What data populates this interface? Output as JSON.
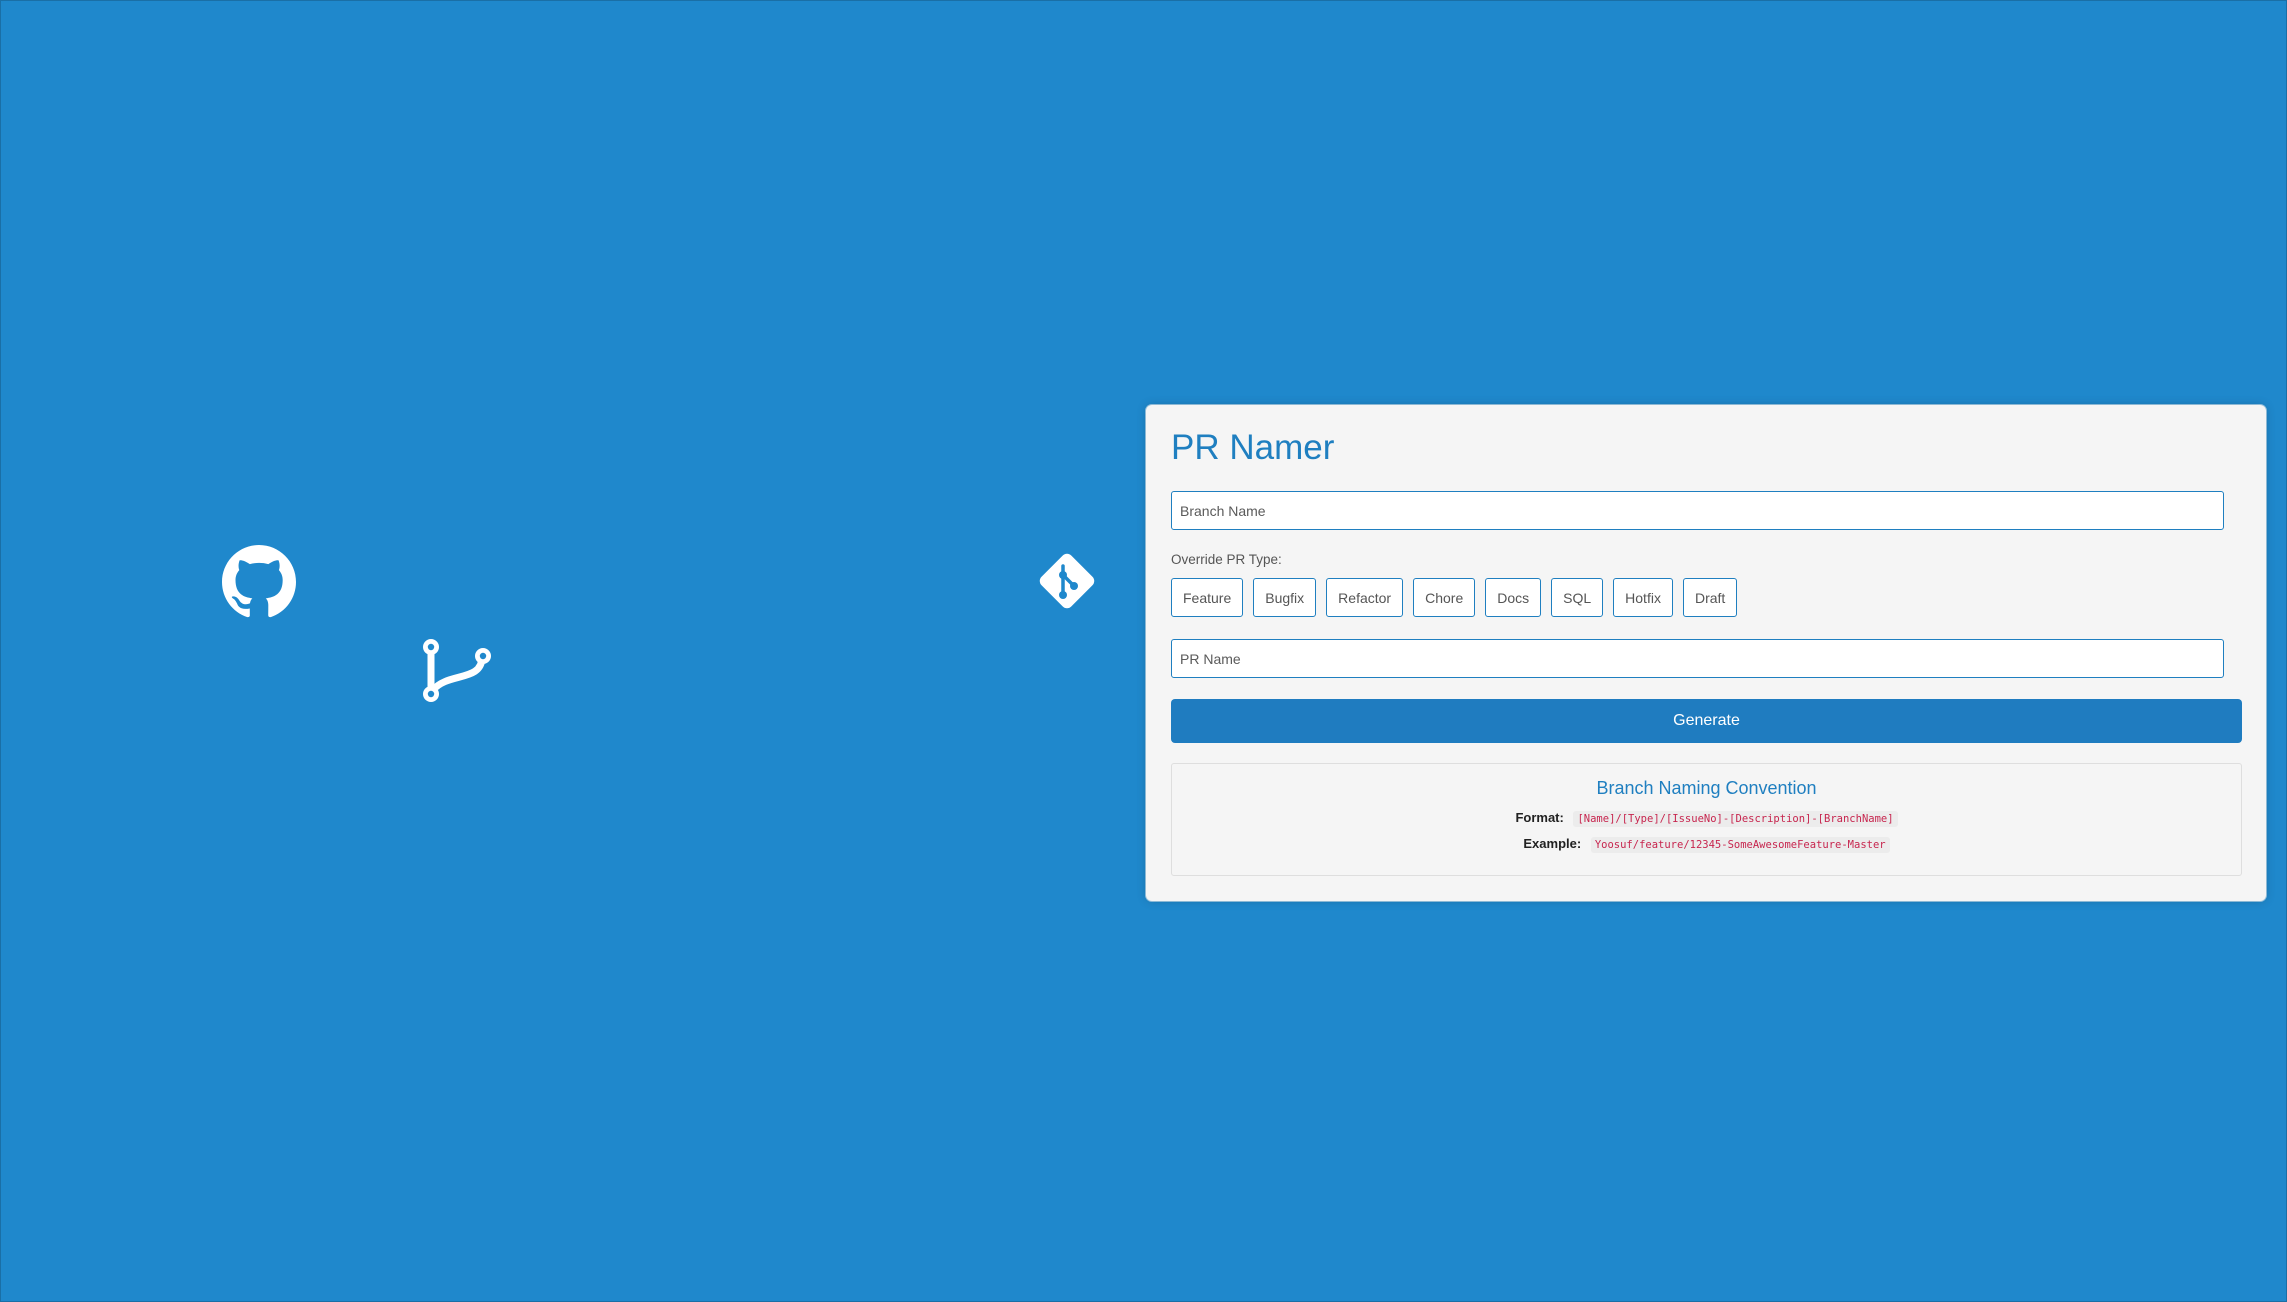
{
  "background_icons": {
    "github": "github-octocat-icon",
    "branch": "git-branch-icon",
    "git": "git-logo-icon"
  },
  "colors": {
    "background": "#1f88cc",
    "accent": "#1f7fc0",
    "card": "#f5f5f5",
    "code_text": "#c7254e"
  },
  "app": {
    "title": "PR Namer"
  },
  "branch_input": {
    "placeholder": "Branch Name",
    "value": ""
  },
  "override": {
    "label": "Override PR Type:",
    "types": [
      "Feature",
      "Bugfix",
      "Refactor",
      "Chore",
      "Docs",
      "SQL",
      "Hotfix",
      "Draft"
    ]
  },
  "pr_name_input": {
    "placeholder": "PR Name",
    "value": ""
  },
  "generate_button": {
    "label": "Generate"
  },
  "convention": {
    "title": "Branch Naming Convention",
    "format_label": "Format:",
    "format_value": "[Name]/[Type]/[IssueNo]-[Description]-[BranchName]",
    "example_label": "Example:",
    "example_value": "Yoosuf/feature/12345-SomeAwesomeFeature-Master"
  }
}
